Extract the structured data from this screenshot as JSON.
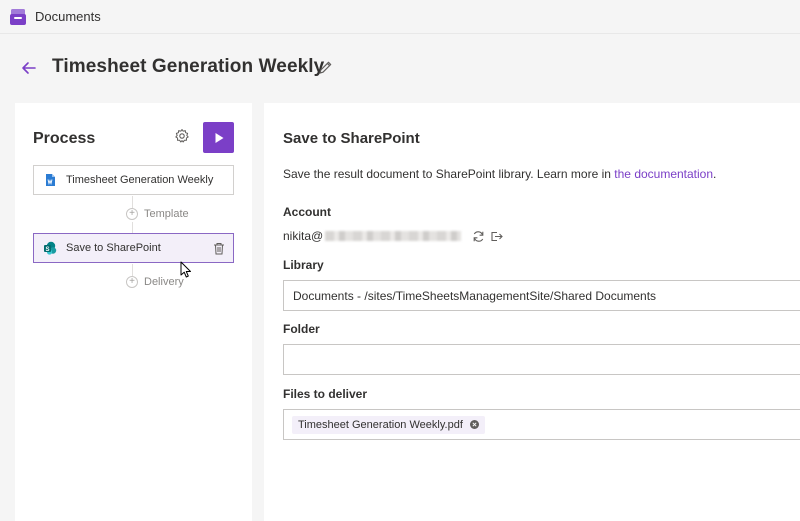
{
  "app": {
    "name": "Documents",
    "brand_color": "#7b3fc7",
    "icon": "documents-app-icon"
  },
  "header": {
    "title": "Timesheet Generation Weekly",
    "back_icon": "arrow-left-icon",
    "edit_icon": "pencil-icon"
  },
  "process": {
    "title": "Process",
    "settings_icon": "gear-icon",
    "run_icon": "play-icon",
    "steps": [
      {
        "label": "Timesheet Generation Weekly",
        "icon": "word-document-icon",
        "selected": false
      },
      {
        "label": "Save to SharePoint",
        "icon": "sharepoint-icon",
        "selected": true
      }
    ],
    "connectors": [
      {
        "label": "Template"
      },
      {
        "label": "Delivery"
      }
    ]
  },
  "detail": {
    "title": "Save to SharePoint",
    "description": "Save the result document to SharePoint library. Learn more in ",
    "link_text": "the documentation",
    "description_end": ".",
    "account": {
      "label": "Account",
      "value_prefix": "nikita@",
      "refresh_icon": "refresh-icon",
      "signout_icon": "sign-out-icon"
    },
    "library": {
      "label": "Library",
      "value": "Documents - /sites/TimeSheetsManagementSite/Shared Documents"
    },
    "folder": {
      "label": "Folder",
      "value": ""
    },
    "files": {
      "label": "Files to deliver",
      "items": [
        "Timesheet Generation Weekly.pdf"
      ]
    }
  }
}
